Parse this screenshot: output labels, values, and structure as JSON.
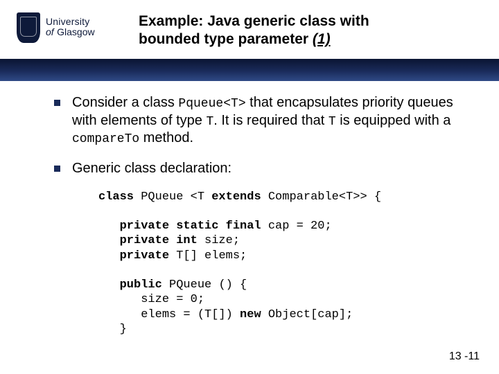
{
  "logo": {
    "line1": "University",
    "line2": "of",
    "line3": "Glasgow"
  },
  "title": {
    "line1": "Example: Java generic class with",
    "line2_plain": "bounded type parameter ",
    "line2_ital": "(1)"
  },
  "bullets": {
    "b1": {
      "t1": "Consider a class ",
      "c1": "Pqueue<T>",
      "t2": " that encapsulates priority queues with elements of type ",
      "c2": "T",
      "t3": ". It is required that ",
      "c3": "T",
      "t4": " is equipped with a ",
      "c4": "compareTo",
      "t5": " method."
    },
    "b2": "Generic class declaration:"
  },
  "code": {
    "l1a": "class",
    "l1b": " PQueue <T ",
    "l1c": "extends",
    "l1d": " Comparable<T>> {",
    "blank1": "",
    "l2a": "   private static final",
    "l2b": " cap = 20;",
    "l3a": "   private int",
    "l3b": " size;",
    "l4a": "   private",
    "l4b": " T[] elems;",
    "blank2": "",
    "l5a": "   public",
    "l5b": " PQueue () {",
    "l6": "      size = 0;",
    "l7a": "      elems = (T[]) ",
    "l7b": "new",
    "l7c": " Object[cap];",
    "l8": "   }"
  },
  "footer": "13 -11"
}
